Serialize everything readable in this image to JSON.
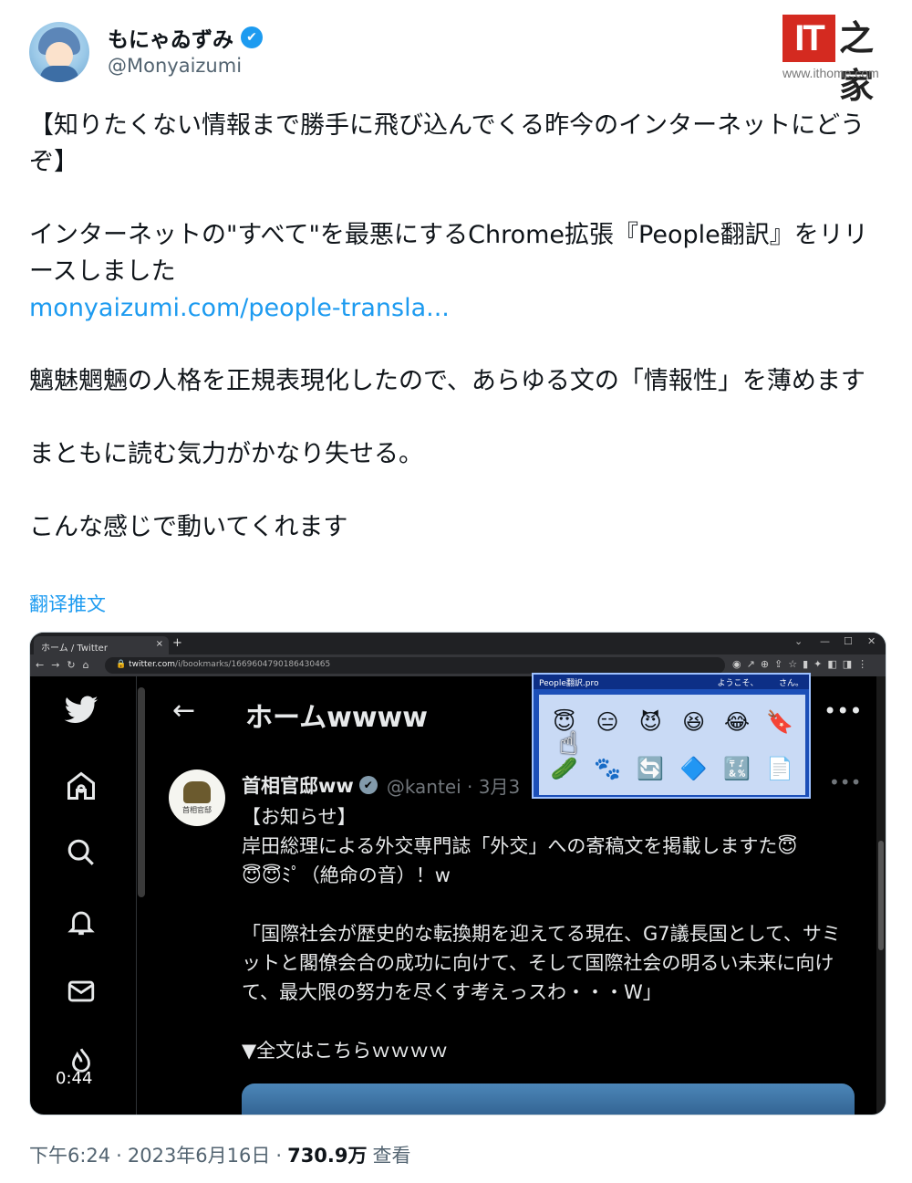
{
  "author": {
    "display_name": "もにゃゐずみ",
    "handle": "@Monyaizumi",
    "verified_icon": "✔"
  },
  "watermark": {
    "brand": "IT",
    "brand_suffix": "之家",
    "url": "www.ithome.com"
  },
  "tweet": {
    "paragraph_1": "【知りたくない情報まで勝手に飛び込んでくる昨今のインターネットにどうぞ】",
    "paragraph_2": "インターネットの\"すべて\"を最悪にするChrome拡張『People翻訳』をリリースしました",
    "link": "monyaizumi.com/people-transla...",
    "paragraph_3": "魑魅魍魎の人格を正規表現化したので、あらゆる文の「情報性」を薄めます",
    "paragraph_4": "まともに読む気力がかなり失せる。",
    "paragraph_5": "こんな感じで動いてくれます",
    "translate_label": "翻译推文"
  },
  "video": {
    "browser_tab_title": "ホーム / Twitter",
    "tab_close": "×",
    "new_tab": "+",
    "url_host": "twitter.com",
    "url_path": "/i/bookmarks/1669604790186430465",
    "time_badge": "0:44",
    "page_header": "ホームwwww",
    "back_arrow": "←",
    "more": "•••",
    "post_author": "首相官邸ww",
    "post_handle": "@kantei · 3月3",
    "post_avatar_label": "首相官邸",
    "post_body": "【お知らせ】\n岸田総理による外交専門誌「外交」への寄稿文を掲載しますた😇\n😇😇ﾐﾟ（絶命の音）！w\n\n「国際社会が歴史的な転換期を迎えてる現在、G7議長国として、サミットと閣僚会合の成功に向けて、そして国際社会の明るい未来に向けて、最大限の努力を尽くす考えっスわ・・・W」\n\n▼全文はこちらｗｗｗｗ",
    "popup_title": "People翻訳.pro",
    "popup_greeting": "ようこそ、　　　さん。",
    "popup_icons": [
      "😇",
      "😑",
      "😈",
      "😆",
      "😂",
      "🔖",
      "🥒",
      "🐾",
      "🔄",
      "🔷",
      "🔣",
      "📄"
    ],
    "sidebar_icons": [
      "twitter-bird-icon",
      "home-icon",
      "search-icon",
      "bell-icon",
      "mail-icon",
      "communities-icon"
    ]
  },
  "footer": {
    "time": "下午6:24",
    "sep1": "·",
    "date": "2023年6月16日",
    "sep2": "·",
    "views": "730.9万",
    "views_label": "查看"
  }
}
